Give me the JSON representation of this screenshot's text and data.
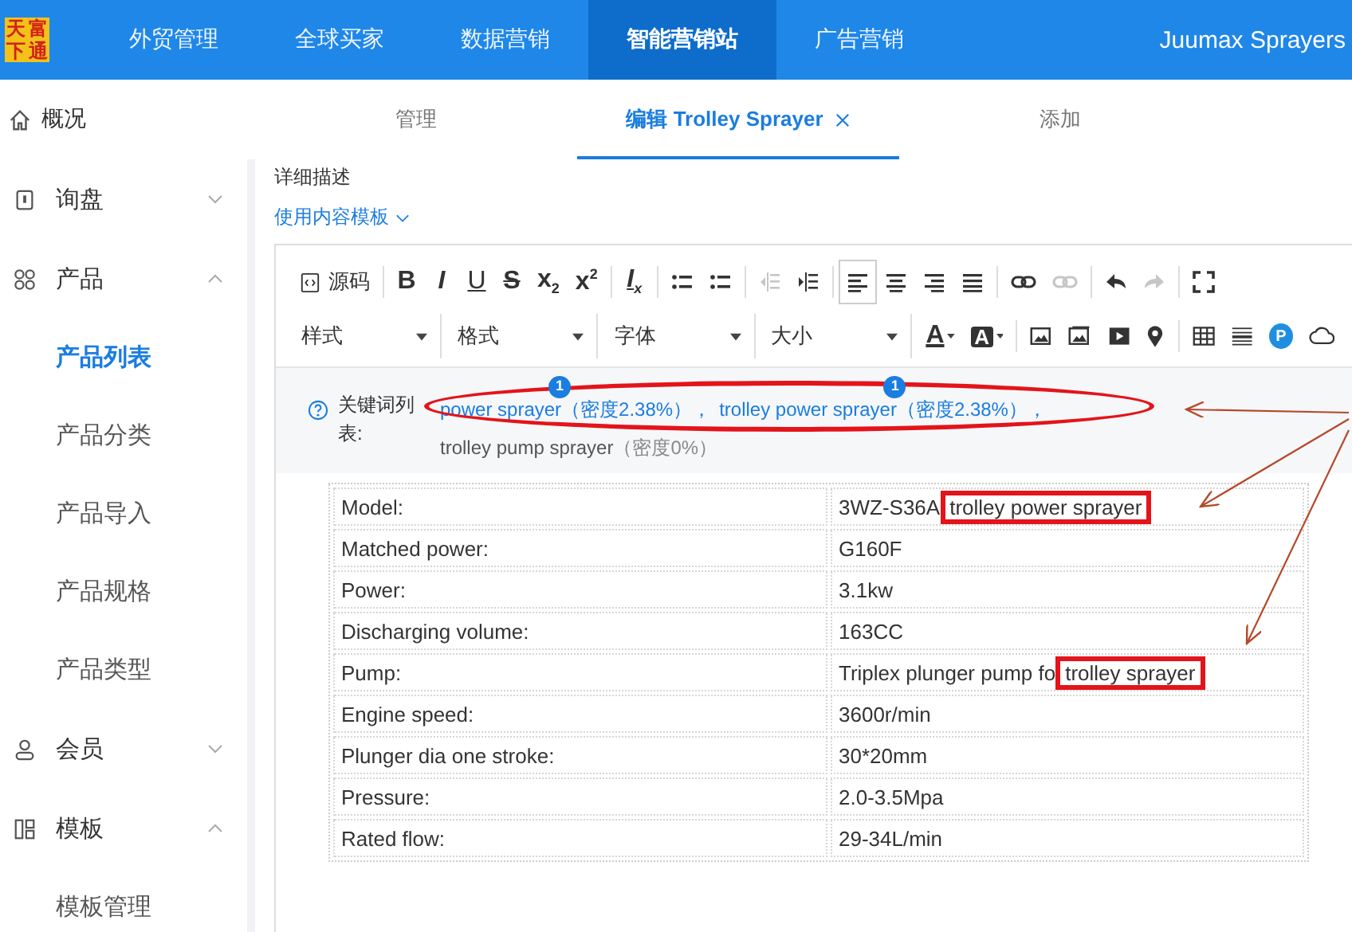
{
  "logo": {
    "chars": [
      "天",
      "富",
      "下",
      "通"
    ]
  },
  "top_nav": {
    "items": [
      {
        "label": "外贸管理",
        "selected": false
      },
      {
        "label": "全球买家",
        "selected": false
      },
      {
        "label": "数据营销",
        "selected": false
      },
      {
        "label": "智能营销站",
        "selected": true
      },
      {
        "label": "广告营销",
        "selected": false
      }
    ],
    "account": "Juumax Sprayers"
  },
  "sidebar": {
    "home": "概况",
    "items": [
      {
        "label": "询盘",
        "expanded": false
      },
      {
        "label": "产品",
        "expanded": true,
        "children": [
          {
            "label": "产品列表",
            "selected": true
          },
          {
            "label": "产品分类",
            "selected": false
          },
          {
            "label": "产品导入",
            "selected": false
          },
          {
            "label": "产品规格",
            "selected": false
          },
          {
            "label": "产品类型",
            "selected": false
          }
        ]
      },
      {
        "label": "会员",
        "expanded": false
      },
      {
        "label": "模板",
        "expanded": true,
        "children": [
          {
            "label": "模板管理",
            "selected": false
          }
        ]
      }
    ]
  },
  "page_tabs": [
    {
      "label": "管理",
      "selected": false,
      "closable": false
    },
    {
      "label": "编辑 Trolley Sprayer",
      "selected": true,
      "closable": true
    },
    {
      "label": "添加",
      "selected": false,
      "closable": false
    }
  ],
  "form": {
    "field_label": "详细描述",
    "template_link": "使用内容模板"
  },
  "toolbar": {
    "row1": [
      [
        {
          "kind": "source",
          "label": "源码",
          "disabled": false,
          "selected": false
        }
      ],
      [
        {
          "kind": "bold",
          "label": "B",
          "disabled": false,
          "selected": false
        },
        {
          "kind": "italic",
          "label": "I",
          "disabled": false,
          "selected": false
        },
        {
          "kind": "underline",
          "label": "U",
          "disabled": false,
          "selected": false
        },
        {
          "kind": "strike",
          "label": "S",
          "disabled": false,
          "selected": false
        },
        {
          "kind": "subscript",
          "label": "x$_{2}$",
          "disabled": false,
          "selected": false
        },
        {
          "kind": "superscript",
          "label": "x$^{2}$",
          "disabled": false,
          "selected": false
        }
      ],
      [
        {
          "kind": "clear",
          "label": "I$_{x}$",
          "disabled": false,
          "selected": false
        }
      ],
      [
        {
          "kind": "ordered",
          "disabled": false,
          "selected": false
        },
        {
          "kind": "bullets",
          "disabled": false,
          "selected": false
        }
      ],
      [
        {
          "kind": "outdent",
          "disabled": true,
          "selected": false
        },
        {
          "kind": "indent",
          "disabled": false,
          "selected": false
        }
      ],
      [
        {
          "kind": "align-left",
          "disabled": false,
          "selected": true
        },
        {
          "kind": "align-center",
          "disabled": false,
          "selected": false
        },
        {
          "kind": "align-right",
          "disabled": false,
          "selected": false
        },
        {
          "kind": "justify",
          "disabled": false,
          "selected": false
        }
      ],
      [
        {
          "kind": "link",
          "disabled": false,
          "selected": false
        },
        {
          "kind": "unlink",
          "disabled": true,
          "selected": false
        }
      ],
      [
        {
          "kind": "undo",
          "disabled": false,
          "selected": false
        },
        {
          "kind": "redo",
          "disabled": true,
          "selected": false
        }
      ],
      [
        {
          "kind": "fullscreen",
          "disabled": false,
          "selected": false
        }
      ]
    ],
    "dropdowns": [
      "样式",
      "格式",
      "字体",
      "大小"
    ],
    "row2": [
      [
        {
          "kind": "font-color",
          "label": "A"
        },
        {
          "kind": "bg-color",
          "label": "A"
        }
      ],
      [
        {
          "kind": "image"
        },
        {
          "kind": "gallery"
        },
        {
          "kind": "video"
        },
        {
          "kind": "map"
        }
      ],
      [
        {
          "kind": "table"
        },
        {
          "kind": "rule"
        },
        {
          "kind": "plugin",
          "label": "P"
        },
        {
          "kind": "cloud"
        }
      ]
    ]
  },
  "keywords": {
    "label": "关键词列表:",
    "separator": "，",
    "items": [
      {
        "term": "power sprayer",
        "density": "（密度2.38%）",
        "badge": "1",
        "matched": true
      },
      {
        "term": "trolley power sprayer",
        "density": "（密度2.38%）",
        "badge": "1",
        "matched": true
      },
      {
        "term": "trolley pump sprayer",
        "density": "（密度0%）",
        "matched": false
      }
    ]
  },
  "spec_table": {
    "rows": [
      {
        "label": "Model:",
        "value": "3WZ-S36A",
        "highlight": "trolley power sprayer"
      },
      {
        "label": "Matched power:",
        "value": "G160F"
      },
      {
        "label": "Power:",
        "value": "3.1kw"
      },
      {
        "label": "Discharging volume:",
        "value": "163CC"
      },
      {
        "label": "Pump:",
        "value": "Triplex plunger pump fo",
        "highlight": "trolley sprayer"
      },
      {
        "label": "Engine speed:",
        "value": "3600r/min"
      },
      {
        "label": "Plunger dia one stroke:",
        "value": "30*20mm"
      },
      {
        "label": "Pressure:",
        "value": "2.0-3.5Mpa"
      },
      {
        "label": "Rated flow:",
        "value": "29-34L/min"
      }
    ]
  }
}
